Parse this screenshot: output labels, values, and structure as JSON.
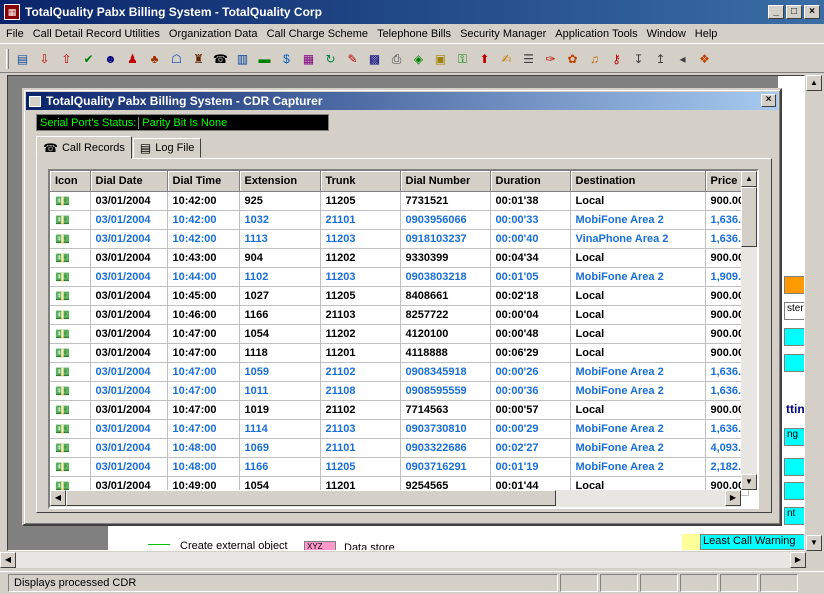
{
  "app": {
    "title": "TotalQuality Pabx Billing System - TotalQuality Corp",
    "status": "Displays processed CDR"
  },
  "menu": [
    "File",
    "Call Detail Record Utilities",
    "Organization Data",
    "Call Charge Scheme",
    "Telephone Bills",
    "Security Manager",
    "Application Tools",
    "Window",
    "Help"
  ],
  "toolbar_icons": [
    "table-icon",
    "download-icon",
    "upload-icon",
    "check-icon",
    "people-icon",
    "person-icon",
    "org-chart-icon",
    "network-icon",
    "building-icon",
    "phone-icon",
    "document-icon",
    "card-icon",
    "money-icon",
    "grid-icon",
    "refresh-icon",
    "report-icon",
    "calendar-icon",
    "printer-icon",
    "chart-icon",
    "box-icon",
    "key-icon",
    "upload-box-icon",
    "edit-icon",
    "users-icon",
    "pen-icon",
    "palette-icon",
    "bell-icon",
    "lock-key-icon",
    "sort-az-icon",
    "sort-za-icon",
    "arrow-left-icon",
    "footprint-icon"
  ],
  "dialog": {
    "title": "TotalQuality Pabx Billing System - CDR Capturer",
    "serial_label": "Serial Port's Status:",
    "serial_value": "Parity Bit Is None",
    "tabs": [
      "Call Records",
      "Log File"
    ]
  },
  "background": {
    "legend_text": "Create external object",
    "data_store": "Data store",
    "xyz": "XYZ",
    "least_call": "Least Call Warning",
    "ster": "ster",
    "ng": "ng",
    "ttin": "ttin",
    "nt": "nt"
  },
  "colors": {
    "local_row": "#000000",
    "mobile_row": "#1a6fd6"
  },
  "table": {
    "columns": [
      "Icon",
      "Dial Date",
      "Dial Time",
      "Extension",
      "Trunk",
      "Dial Number",
      "Duration",
      "Destination",
      "Price"
    ],
    "rows": [
      {
        "date": "03/01/2004",
        "time": "10:42:00",
        "ext": "925",
        "trunk": "11205",
        "num": "7731521",
        "dur": "00:01'38",
        "dest": "Local",
        "price": "900.00",
        "mobile": false
      },
      {
        "date": "03/01/2004",
        "time": "10:42:00",
        "ext": "1032",
        "trunk": "21101",
        "num": "0903956066",
        "dur": "00:00'33",
        "dest": "MobiFone Area 2",
        "price": "1,636.0",
        "mobile": true
      },
      {
        "date": "03/01/2004",
        "time": "10:42:00",
        "ext": "1113",
        "trunk": "11203",
        "num": "0918103237",
        "dur": "00:00'40",
        "dest": "VinaPhone Area 2",
        "price": "1,636.0",
        "mobile": true
      },
      {
        "date": "03/01/2004",
        "time": "10:43:00",
        "ext": "904",
        "trunk": "11202",
        "num": "9330399",
        "dur": "00:04'34",
        "dest": "Local",
        "price": "900.00",
        "mobile": false
      },
      {
        "date": "03/01/2004",
        "time": "10:44:00",
        "ext": "1102",
        "trunk": "11203",
        "num": "0903803218",
        "dur": "00:01'05",
        "dest": "MobiFone Area 2",
        "price": "1,909.0",
        "mobile": true
      },
      {
        "date": "03/01/2004",
        "time": "10:45:00",
        "ext": "1027",
        "trunk": "11205",
        "num": "8408661",
        "dur": "00:02'18",
        "dest": "Local",
        "price": "900.00",
        "mobile": false
      },
      {
        "date": "03/01/2004",
        "time": "10:46:00",
        "ext": "1166",
        "trunk": "21103",
        "num": "8257722",
        "dur": "00:00'04",
        "dest": "Local",
        "price": "900.00",
        "mobile": false
      },
      {
        "date": "03/01/2004",
        "time": "10:47:00",
        "ext": "1054",
        "trunk": "11202",
        "num": "4120100",
        "dur": "00:00'48",
        "dest": "Local",
        "price": "900.00",
        "mobile": false
      },
      {
        "date": "03/01/2004",
        "time": "10:47:00",
        "ext": "1118",
        "trunk": "11201",
        "num": "4118888",
        "dur": "00:06'29",
        "dest": "Local",
        "price": "900.00",
        "mobile": false
      },
      {
        "date": "03/01/2004",
        "time": "10:47:00",
        "ext": "1059",
        "trunk": "21102",
        "num": "0908345918",
        "dur": "00:00'26",
        "dest": "MobiFone Area 2",
        "price": "1,636.0",
        "mobile": true
      },
      {
        "date": "03/01/2004",
        "time": "10:47:00",
        "ext": "1011",
        "trunk": "21108",
        "num": "0908595559",
        "dur": "00:00'36",
        "dest": "MobiFone Area 2",
        "price": "1,636.0",
        "mobile": true
      },
      {
        "date": "03/01/2004",
        "time": "10:47:00",
        "ext": "1019",
        "trunk": "21102",
        "num": "7714563",
        "dur": "00:00'57",
        "dest": "Local",
        "price": "900.00",
        "mobile": false
      },
      {
        "date": "03/01/2004",
        "time": "10:47:00",
        "ext": "1114",
        "trunk": "21103",
        "num": "0903730810",
        "dur": "00:00'29",
        "dest": "MobiFone Area 2",
        "price": "1,636.0",
        "mobile": true
      },
      {
        "date": "03/01/2004",
        "time": "10:48:00",
        "ext": "1069",
        "trunk": "21101",
        "num": "0903322686",
        "dur": "00:02'27",
        "dest": "MobiFone Area 2",
        "price": "4,093.0",
        "mobile": true
      },
      {
        "date": "03/01/2004",
        "time": "10:48:00",
        "ext": "1166",
        "trunk": "11205",
        "num": "0903716291",
        "dur": "00:01'19",
        "dest": "MobiFone Area 2",
        "price": "2,182.0",
        "mobile": true
      },
      {
        "date": "03/01/2004",
        "time": "10:49:00",
        "ext": "1054",
        "trunk": "11201",
        "num": "9254565",
        "dur": "00:01'44",
        "dest": "Local",
        "price": "900.00",
        "mobile": false
      }
    ]
  }
}
